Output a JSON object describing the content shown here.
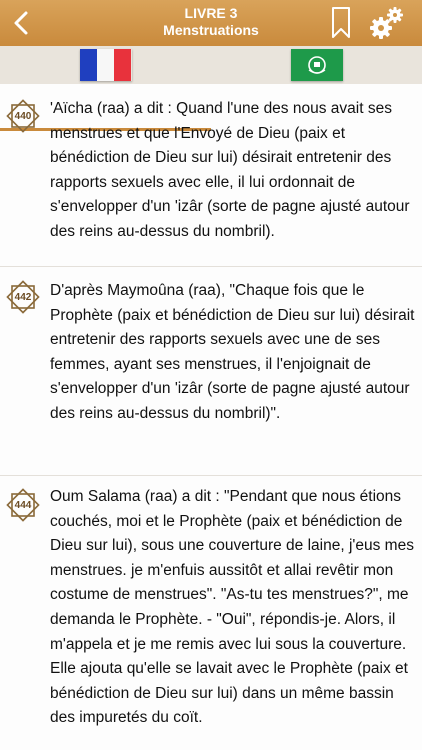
{
  "header": {
    "title_line1": "LIVRE 3",
    "title_line2": "Menstruations"
  },
  "icons": {
    "back": "chevron-left-icon",
    "bookmark": "bookmark-icon",
    "settings": "gears-icon"
  },
  "tabs": [
    {
      "name": "french",
      "flag": "france-flag",
      "selected": true
    },
    {
      "name": "arabic",
      "flag": "arab-league-flag",
      "selected": false
    }
  ],
  "colors": {
    "header": "#c98a3c",
    "badge": "#8a6a3a"
  },
  "hadiths": [
    {
      "number": "440",
      "text": "'Aïcha (raa) a dit : Quand l'une des nous avait ses menstrues et que l'Envoyé de Dieu (paix et bénédiction de Dieu sur lui) désirait entretenir des rapports sexuels avec elle, il lui ordonnait de s'envelopper d'un 'izâr (sorte de pagne ajusté autour des reins au-dessus du nombril)."
    },
    {
      "number": "442",
      "text": "D'après Maymoûna (raa), \"Chaque fois que le Prophète (paix et bénédiction de Dieu sur lui) désirait entretenir des rapports sexuels avec une de ses femmes, ayant ses menstrues, il l'enjoignait de s'envelopper d'un 'izâr (sorte de pagne ajusté autour des reins au-dessus du nombril)\"."
    },
    {
      "number": "444",
      "text": "Oum Salama (raa) a dit : \"Pendant que nous étions couchés, moi et le Prophète (paix et bénédiction de Dieu sur lui), sous une couverture de laine, j'eus mes menstrues. je m'enfuis aussitôt et allai revêtir mon costume de menstrues\". \"As-tu tes menstrues?\", me demanda le Prophète. - \"Oui\", répondis-je. Alors, il m'appela et je me remis avec lui sous la couverture. Elle ajouta qu'elle se lavait avec le Prophète (paix et bénédiction de Dieu sur lui) dans un même bassin des impuretés du coït."
    }
  ]
}
